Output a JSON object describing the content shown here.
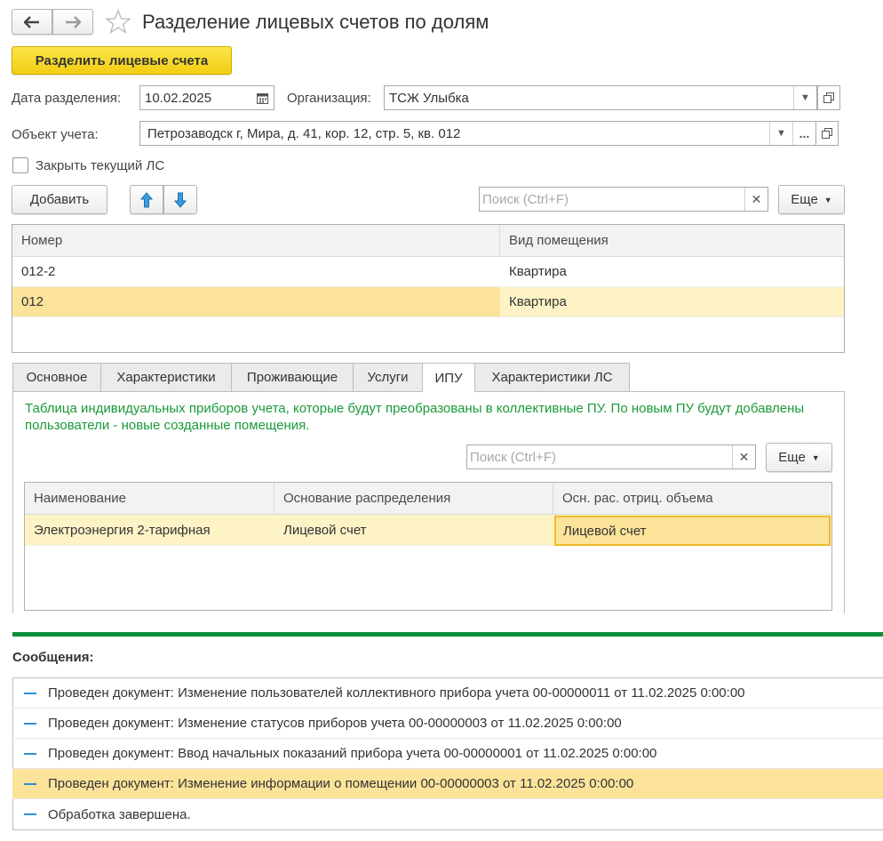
{
  "window": {
    "title": "Разделение лицевых счетов по долям"
  },
  "toolbar": {
    "split_button": "Разделить лицевые счета"
  },
  "form": {
    "date_label": "Дата разделения:",
    "date_value": "10.02.2025",
    "org_label": "Организация:",
    "org_value": "ТСЖ Улыбка",
    "object_label": "Объект учета:",
    "object_value": "Петрозаводск г, Мира, д. 41, кор. 12, стр. 5, кв. 012",
    "close_checkbox_label": "Закрыть текущий ЛС",
    "close_checked": false
  },
  "table1": {
    "add_button": "Добавить",
    "search_placeholder": "Поиск (Ctrl+F)",
    "more_button": "Еще",
    "columns": [
      "Номер",
      "Вид помещения"
    ],
    "rows": [
      [
        "012-2",
        "Квартира"
      ],
      [
        "012",
        "Квартира"
      ]
    ]
  },
  "tabs": [
    "Основное",
    "Характеристики",
    "Проживающие",
    "Услуги",
    "ИПУ",
    "Характеристики ЛС"
  ],
  "ipu": {
    "info": "Таблица индивидуальных приборов учета, которые будут преобразованы в коллективные ПУ. По новым ПУ будут добавлены пользователи - новые созданные помещения.",
    "search_placeholder": "Поиск (Ctrl+F)",
    "more_button": "Еще",
    "columns": [
      "Наименование",
      "Основание распределения",
      "Осн. рас. отриц. объема"
    ],
    "rows": [
      [
        "Электроэнергия 2-тарифная",
        "Лицевой счет",
        "Лицевой счет"
      ]
    ]
  },
  "messages": {
    "title": "Сообщения:",
    "items": [
      "Проведен документ: Изменение пользователей коллективного прибора учета 00-00000011 от 11.02.2025 0:00:00",
      "Проведен документ: Изменение статусов приборов учета 00-00000003 от 11.02.2025 0:00:00",
      "Проведен документ: Ввод начальных показаний прибора учета 00-00000001 от 11.02.2025 0:00:00",
      "Проведен документ: Изменение информации о помещении 00-00000003 от 11.02.2025 0:00:00",
      "Обработка завершена."
    ]
  },
  "colors": {
    "accent_yellow": "#f5d31c",
    "selected_row": "#fbe39a",
    "selected_row_light": "#fdf3c6",
    "info_green": "#1a9a3a",
    "divider_green": "#0f8f3c",
    "message_dash": "#2f8fd6"
  }
}
